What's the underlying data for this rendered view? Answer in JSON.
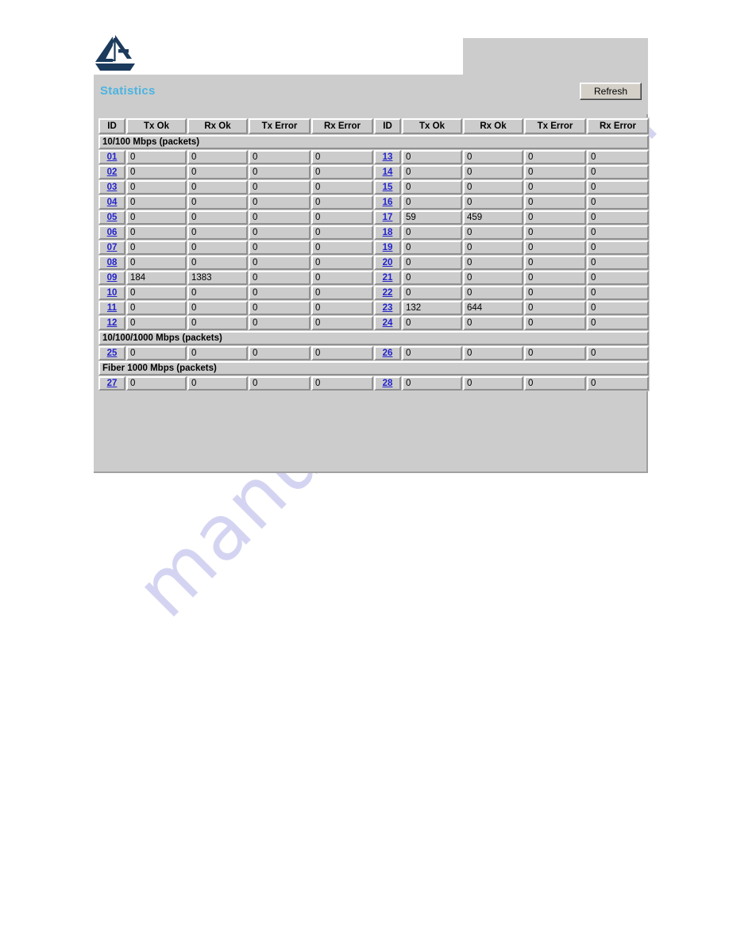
{
  "header": {
    "logo_icon": "airlive-triangle-a-logo",
    "title": "Statistics",
    "refresh_label": "Refresh"
  },
  "watermark": {
    "text": "manualshive.com"
  },
  "colors": {
    "title_blue": "#4bb4e0",
    "section_teal": "#0d8a80",
    "link_blue": "#2222cc",
    "panel_gray": "#cccccc",
    "logo_navy": "#1b3a5c"
  },
  "table": {
    "columns": [
      "ID",
      "Tx Ok",
      "Rx Ok",
      "Tx Error",
      "Rx Error",
      "ID",
      "Tx Ok",
      "Rx Ok",
      "Tx Error",
      "Rx Error"
    ],
    "sections": [
      {
        "label": "10/100 Mbps (packets)",
        "rows": [
          {
            "left_id": "01",
            "left": [
              "0",
              "0",
              "0",
              "0"
            ],
            "right_id": "13",
            "right": [
              "0",
              "0",
              "0",
              "0"
            ]
          },
          {
            "left_id": "02",
            "left": [
              "0",
              "0",
              "0",
              "0"
            ],
            "right_id": "14",
            "right": [
              "0",
              "0",
              "0",
              "0"
            ]
          },
          {
            "left_id": "03",
            "left": [
              "0",
              "0",
              "0",
              "0"
            ],
            "right_id": "15",
            "right": [
              "0",
              "0",
              "0",
              "0"
            ]
          },
          {
            "left_id": "04",
            "left": [
              "0",
              "0",
              "0",
              "0"
            ],
            "right_id": "16",
            "right": [
              "0",
              "0",
              "0",
              "0"
            ]
          },
          {
            "left_id": "05",
            "left": [
              "0",
              "0",
              "0",
              "0"
            ],
            "right_id": "17",
            "right": [
              "59",
              "459",
              "0",
              "0"
            ]
          },
          {
            "left_id": "06",
            "left": [
              "0",
              "0",
              "0",
              "0"
            ],
            "right_id": "18",
            "right": [
              "0",
              "0",
              "0",
              "0"
            ]
          },
          {
            "left_id": "07",
            "left": [
              "0",
              "0",
              "0",
              "0"
            ],
            "right_id": "19",
            "right": [
              "0",
              "0",
              "0",
              "0"
            ]
          },
          {
            "left_id": "08",
            "left": [
              "0",
              "0",
              "0",
              "0"
            ],
            "right_id": "20",
            "right": [
              "0",
              "0",
              "0",
              "0"
            ]
          },
          {
            "left_id": "09",
            "left": [
              "184",
              "1383",
              "0",
              "0"
            ],
            "right_id": "21",
            "right": [
              "0",
              "0",
              "0",
              "0"
            ]
          },
          {
            "left_id": "10",
            "left": [
              "0",
              "0",
              "0",
              "0"
            ],
            "right_id": "22",
            "right": [
              "0",
              "0",
              "0",
              "0"
            ]
          },
          {
            "left_id": "11",
            "left": [
              "0",
              "0",
              "0",
              "0"
            ],
            "right_id": "23",
            "right": [
              "132",
              "644",
              "0",
              "0"
            ]
          },
          {
            "left_id": "12",
            "left": [
              "0",
              "0",
              "0",
              "0"
            ],
            "right_id": "24",
            "right": [
              "0",
              "0",
              "0",
              "0"
            ]
          }
        ]
      },
      {
        "label": "10/100/1000 Mbps (packets)",
        "rows": [
          {
            "left_id": "25",
            "left": [
              "0",
              "0",
              "0",
              "0"
            ],
            "right_id": "26",
            "right": [
              "0",
              "0",
              "0",
              "0"
            ]
          }
        ]
      },
      {
        "label": "Fiber 1000 Mbps (packets)",
        "rows": [
          {
            "left_id": "27",
            "left": [
              "0",
              "0",
              "0",
              "0"
            ],
            "right_id": "28",
            "right": [
              "0",
              "0",
              "0",
              "0"
            ]
          }
        ]
      }
    ]
  }
}
